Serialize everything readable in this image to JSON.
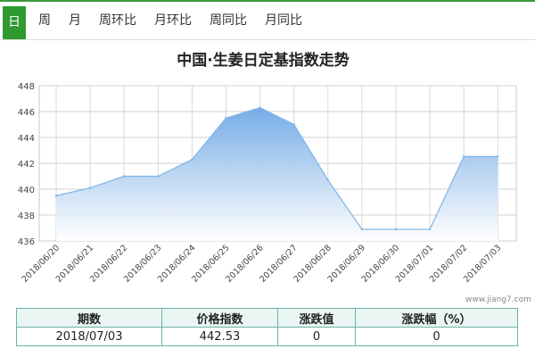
{
  "tabs": [
    {
      "label": "日",
      "active": true
    },
    {
      "label": "周",
      "active": false
    },
    {
      "label": "月",
      "active": false
    },
    {
      "label": "周环比",
      "active": false
    },
    {
      "label": "月环比",
      "active": false
    },
    {
      "label": "周同比",
      "active": false
    },
    {
      "label": "月同比",
      "active": false
    }
  ],
  "watermark": "www.jiang7.com",
  "chart_data": {
    "type": "area",
    "title": "中国·生姜日定基指数走势",
    "xlabel": "",
    "ylabel": "",
    "categories": [
      "2018/06/20",
      "2018/06/21",
      "2018/06/22",
      "2018/06/23",
      "2018/06/24",
      "2018/06/25",
      "2018/06/26",
      "2018/06/27",
      "2018/06/28",
      "2018/06/29",
      "2018/06/30",
      "2018/07/01",
      "2018/07/02",
      "2018/07/03"
    ],
    "series": [
      {
        "values": [
          439.5,
          440.1,
          441.0,
          441.0,
          442.3,
          445.5,
          446.3,
          445.0,
          440.7,
          436.9,
          436.9,
          436.9,
          442.53,
          442.53
        ]
      }
    ],
    "ylim": [
      436,
      448
    ],
    "yticks": [
      436,
      438,
      440,
      442,
      444,
      446,
      448
    ],
    "grid": true,
    "line_color": "#7fb4e6",
    "fill_top_color": "#6fa8e6",
    "fill_bottom_color": "#ffffff"
  },
  "summary_table": {
    "headers": [
      "期数",
      "价格指数",
      "涨跌值",
      "涨跌幅（%）"
    ],
    "row": [
      "2018/07/03",
      "442.53",
      "0",
      "0"
    ]
  }
}
